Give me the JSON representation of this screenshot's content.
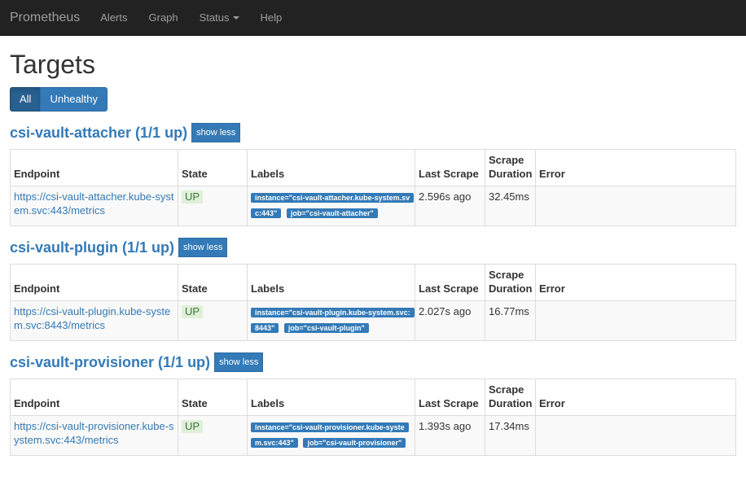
{
  "navbar": {
    "brand": "Prometheus",
    "items": [
      {
        "label": "Alerts"
      },
      {
        "label": "Graph"
      },
      {
        "label": "Status"
      },
      {
        "label": "Help"
      }
    ]
  },
  "page": {
    "title": "Targets",
    "filters": [
      {
        "label": "All",
        "active": true
      },
      {
        "label": "Unhealthy",
        "active": false
      }
    ]
  },
  "table_headers": {
    "endpoint": "Endpoint",
    "state": "State",
    "labels": "Labels",
    "last_scrape": "Last Scrape",
    "scrape_duration": "Scrape Duration",
    "error": "Error"
  },
  "jobs": [
    {
      "title": "csi-vault-attacher (1/1 up)",
      "toggle_label": "show less",
      "targets": [
        {
          "endpoint": "https://csi-vault-attacher.kube-system.svc:443/metrics",
          "state": "UP",
          "labels": [
            "instance=\"csi-vault-attacher.kube-system.svc:443\"",
            "job=\"csi-vault-attacher\""
          ],
          "last_scrape": "2.596s ago",
          "scrape_duration": "32.45ms",
          "error": ""
        }
      ]
    },
    {
      "title": "csi-vault-plugin (1/1 up)",
      "toggle_label": "show less",
      "targets": [
        {
          "endpoint": "https://csi-vault-plugin.kube-system.svc:8443/metrics",
          "state": "UP",
          "labels": [
            "instance=\"csi-vault-plugin.kube-system.svc:8443\"",
            "job=\"csi-vault-plugin\""
          ],
          "last_scrape": "2.027s ago",
          "scrape_duration": "16.77ms",
          "error": ""
        }
      ]
    },
    {
      "title": "csi-vault-provisioner (1/1 up)",
      "toggle_label": "show less",
      "targets": [
        {
          "endpoint": "https://csi-vault-provisioner.kube-system.svc:443/metrics",
          "state": "UP",
          "labels": [
            "instance=\"csi-vault-provisioner.kube-system.svc:443\"",
            "job=\"csi-vault-provisioner\""
          ],
          "last_scrape": "1.393s ago",
          "scrape_duration": "17.34ms",
          "error": ""
        }
      ]
    }
  ],
  "colors": {
    "navbar_bg": "#222222",
    "link": "#337ab7",
    "up_bg": "#dff0d8",
    "up_text": "#3c763d"
  }
}
